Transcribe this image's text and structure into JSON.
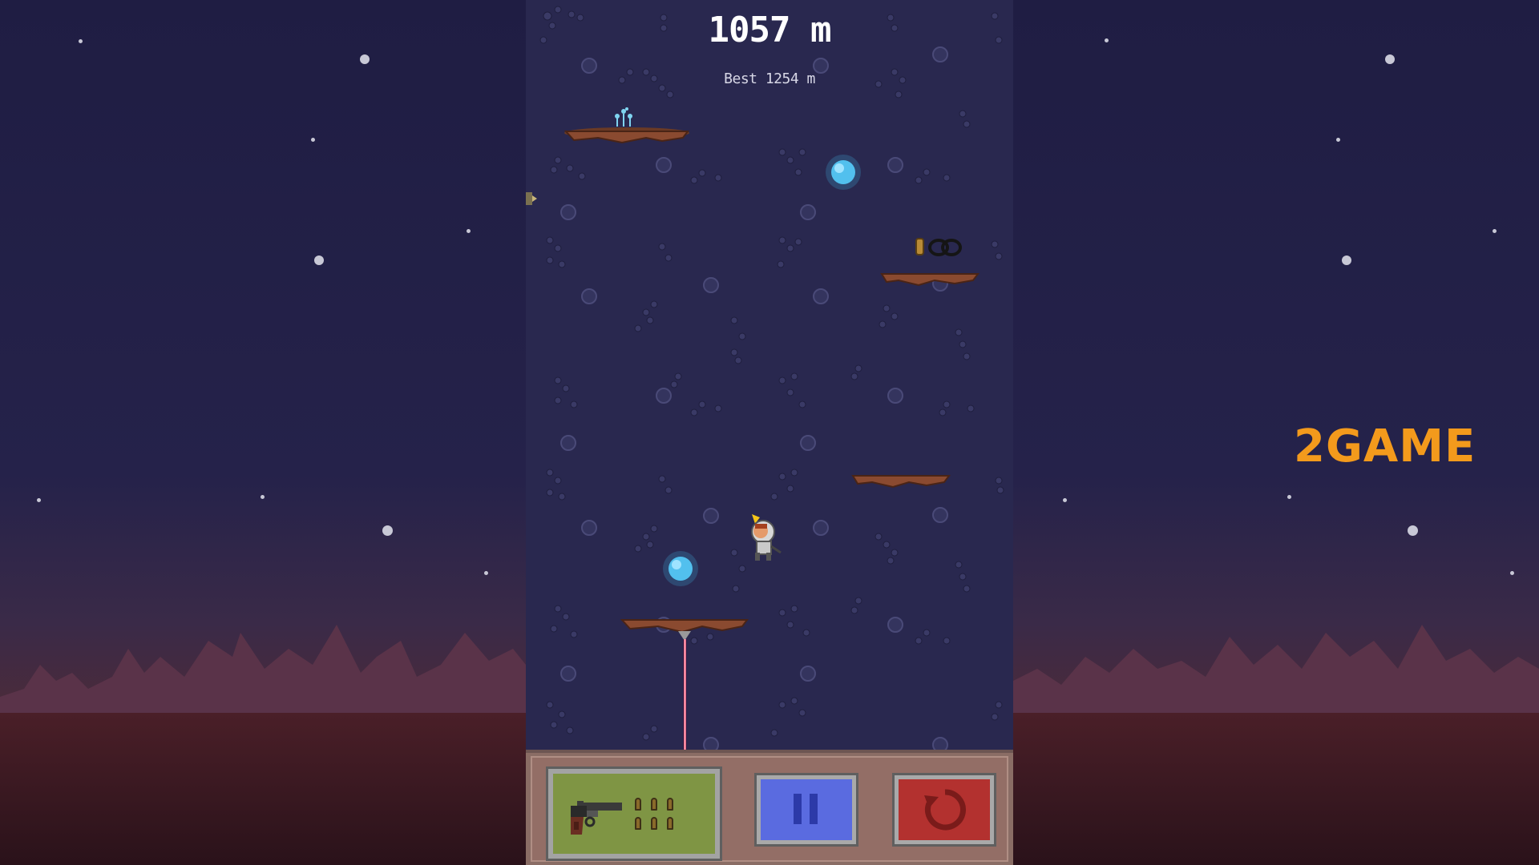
{
  "game": {
    "distance": "1057 m",
    "best": "Best 1254 m"
  },
  "hud": {
    "weapon": {
      "icon": "revolver-icon",
      "ammo": 6
    },
    "pause_icon": "pause-icon",
    "restart_icon": "restart-icon"
  },
  "pickup": {
    "icon": "infinite-ammo-icon"
  },
  "brand": {
    "logo": "2GAME"
  },
  "colors": {
    "background": "#29284f",
    "weapon_button": "#7f9544",
    "pause_button": "#5a6be0",
    "restart_button": "#b3312f",
    "logo": "#f39a1c"
  }
}
